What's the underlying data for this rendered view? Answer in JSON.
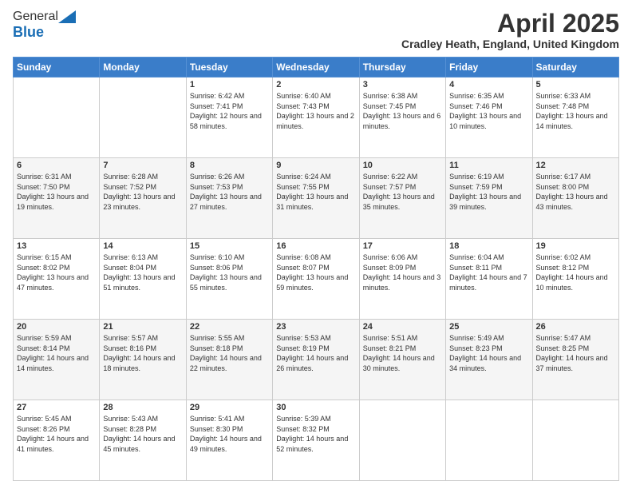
{
  "logo": {
    "general": "General",
    "blue": "Blue"
  },
  "title": "April 2025",
  "subtitle": "Cradley Heath, England, United Kingdom",
  "days_of_week": [
    "Sunday",
    "Monday",
    "Tuesday",
    "Wednesday",
    "Thursday",
    "Friday",
    "Saturday"
  ],
  "weeks": [
    [
      {
        "day": "",
        "info": ""
      },
      {
        "day": "",
        "info": ""
      },
      {
        "day": "1",
        "info": "Sunrise: 6:42 AM\nSunset: 7:41 PM\nDaylight: 12 hours and 58 minutes."
      },
      {
        "day": "2",
        "info": "Sunrise: 6:40 AM\nSunset: 7:43 PM\nDaylight: 13 hours and 2 minutes."
      },
      {
        "day": "3",
        "info": "Sunrise: 6:38 AM\nSunset: 7:45 PM\nDaylight: 13 hours and 6 minutes."
      },
      {
        "day": "4",
        "info": "Sunrise: 6:35 AM\nSunset: 7:46 PM\nDaylight: 13 hours and 10 minutes."
      },
      {
        "day": "5",
        "info": "Sunrise: 6:33 AM\nSunset: 7:48 PM\nDaylight: 13 hours and 14 minutes."
      }
    ],
    [
      {
        "day": "6",
        "info": "Sunrise: 6:31 AM\nSunset: 7:50 PM\nDaylight: 13 hours and 19 minutes."
      },
      {
        "day": "7",
        "info": "Sunrise: 6:28 AM\nSunset: 7:52 PM\nDaylight: 13 hours and 23 minutes."
      },
      {
        "day": "8",
        "info": "Sunrise: 6:26 AM\nSunset: 7:53 PM\nDaylight: 13 hours and 27 minutes."
      },
      {
        "day": "9",
        "info": "Sunrise: 6:24 AM\nSunset: 7:55 PM\nDaylight: 13 hours and 31 minutes."
      },
      {
        "day": "10",
        "info": "Sunrise: 6:22 AM\nSunset: 7:57 PM\nDaylight: 13 hours and 35 minutes."
      },
      {
        "day": "11",
        "info": "Sunrise: 6:19 AM\nSunset: 7:59 PM\nDaylight: 13 hours and 39 minutes."
      },
      {
        "day": "12",
        "info": "Sunrise: 6:17 AM\nSunset: 8:00 PM\nDaylight: 13 hours and 43 minutes."
      }
    ],
    [
      {
        "day": "13",
        "info": "Sunrise: 6:15 AM\nSunset: 8:02 PM\nDaylight: 13 hours and 47 minutes."
      },
      {
        "day": "14",
        "info": "Sunrise: 6:13 AM\nSunset: 8:04 PM\nDaylight: 13 hours and 51 minutes."
      },
      {
        "day": "15",
        "info": "Sunrise: 6:10 AM\nSunset: 8:06 PM\nDaylight: 13 hours and 55 minutes."
      },
      {
        "day": "16",
        "info": "Sunrise: 6:08 AM\nSunset: 8:07 PM\nDaylight: 13 hours and 59 minutes."
      },
      {
        "day": "17",
        "info": "Sunrise: 6:06 AM\nSunset: 8:09 PM\nDaylight: 14 hours and 3 minutes."
      },
      {
        "day": "18",
        "info": "Sunrise: 6:04 AM\nSunset: 8:11 PM\nDaylight: 14 hours and 7 minutes."
      },
      {
        "day": "19",
        "info": "Sunrise: 6:02 AM\nSunset: 8:12 PM\nDaylight: 14 hours and 10 minutes."
      }
    ],
    [
      {
        "day": "20",
        "info": "Sunrise: 5:59 AM\nSunset: 8:14 PM\nDaylight: 14 hours and 14 minutes."
      },
      {
        "day": "21",
        "info": "Sunrise: 5:57 AM\nSunset: 8:16 PM\nDaylight: 14 hours and 18 minutes."
      },
      {
        "day": "22",
        "info": "Sunrise: 5:55 AM\nSunset: 8:18 PM\nDaylight: 14 hours and 22 minutes."
      },
      {
        "day": "23",
        "info": "Sunrise: 5:53 AM\nSunset: 8:19 PM\nDaylight: 14 hours and 26 minutes."
      },
      {
        "day": "24",
        "info": "Sunrise: 5:51 AM\nSunset: 8:21 PM\nDaylight: 14 hours and 30 minutes."
      },
      {
        "day": "25",
        "info": "Sunrise: 5:49 AM\nSunset: 8:23 PM\nDaylight: 14 hours and 34 minutes."
      },
      {
        "day": "26",
        "info": "Sunrise: 5:47 AM\nSunset: 8:25 PM\nDaylight: 14 hours and 37 minutes."
      }
    ],
    [
      {
        "day": "27",
        "info": "Sunrise: 5:45 AM\nSunset: 8:26 PM\nDaylight: 14 hours and 41 minutes."
      },
      {
        "day": "28",
        "info": "Sunrise: 5:43 AM\nSunset: 8:28 PM\nDaylight: 14 hours and 45 minutes."
      },
      {
        "day": "29",
        "info": "Sunrise: 5:41 AM\nSunset: 8:30 PM\nDaylight: 14 hours and 49 minutes."
      },
      {
        "day": "30",
        "info": "Sunrise: 5:39 AM\nSunset: 8:32 PM\nDaylight: 14 hours and 52 minutes."
      },
      {
        "day": "",
        "info": ""
      },
      {
        "day": "",
        "info": ""
      },
      {
        "day": "",
        "info": ""
      }
    ]
  ]
}
